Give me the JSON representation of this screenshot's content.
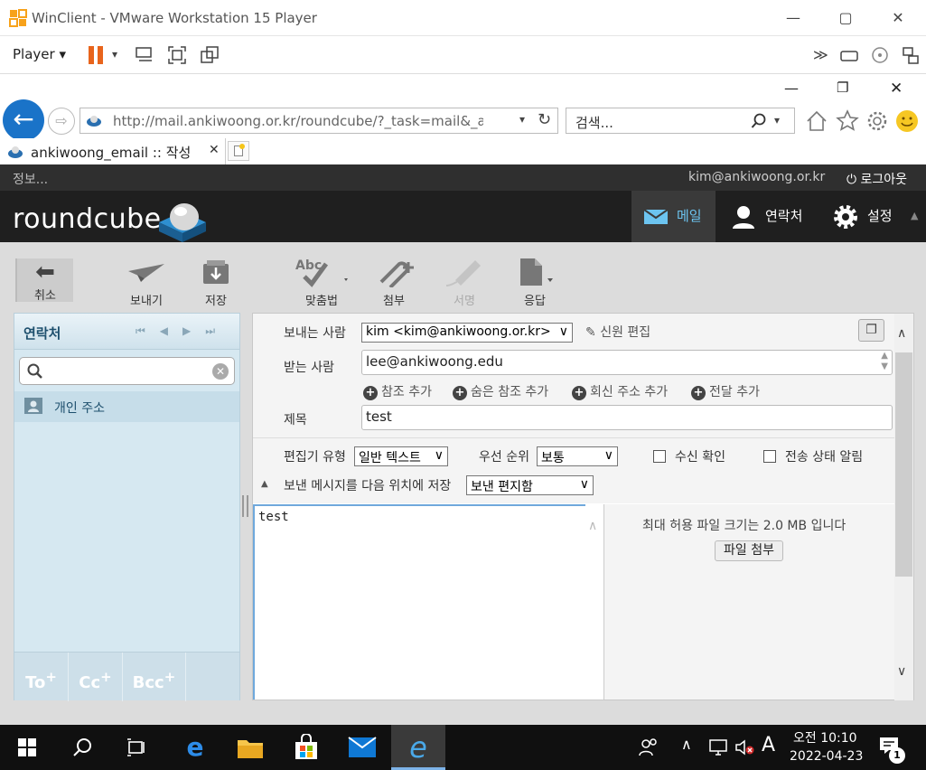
{
  "vmware": {
    "title": "WinClient - VMware Workstation 15 Player",
    "menu_label": "Player"
  },
  "browser": {
    "url": "http://mail.ankiwoong.or.kr/roundcube/?_task=mail&_action=cor",
    "search_placeholder": "검색...",
    "tab_title": "ankiwoong_email :: 작성"
  },
  "roundcube": {
    "info_label": "정보...",
    "user_email": "kim@ankiwoong.or.kr",
    "logout_label": "로그아웃",
    "logo_text": "roundcube",
    "nav": [
      {
        "label": "메일"
      },
      {
        "label": "연락처"
      },
      {
        "label": "설정"
      }
    ],
    "toolbar": {
      "cancel": "취소",
      "send": "보내기",
      "save": "저장",
      "spell": "맞춤법",
      "attach": "첨부",
      "signature": "서명",
      "response": "응답"
    },
    "contacts": {
      "title": "연락처",
      "address_book": "개인 주소",
      "footer": [
        "To",
        "Cc",
        "Bcc"
      ]
    },
    "compose": {
      "from_label": "보내는 사람",
      "from_value": "kim <kim@ankiwoong.or.kr>",
      "edit_identity": "신원 편집",
      "to_label": "받는 사람",
      "to_value": "lee@ankiwoong.edu",
      "add_cc": "참조 추가",
      "add_bcc": "숨은 참조 추가",
      "add_replyto": "회신 주소 추가",
      "add_followupto": "전달 추가",
      "subject_label": "제목",
      "subject_value": "test",
      "editor_type_label": "편집기 유형",
      "editor_type_value": "일반 텍스트",
      "priority_label": "우선 순위",
      "priority_value": "보통",
      "receipt_label": "수신 확인",
      "dsn_label": "전송 상태 알림",
      "save_sent_label": "보낸 메시지를 다음 위치에 저장",
      "save_sent_value": "보낸 편지함",
      "body": "test",
      "max_file_size": "최대 허용 파일 크기는 2.0 MB 입니다",
      "attach_button": "파일 첨부"
    }
  },
  "taskbar": {
    "time": "오전 10:10",
    "date": "2022-04-23",
    "ime": "A",
    "notification_count": "1"
  }
}
